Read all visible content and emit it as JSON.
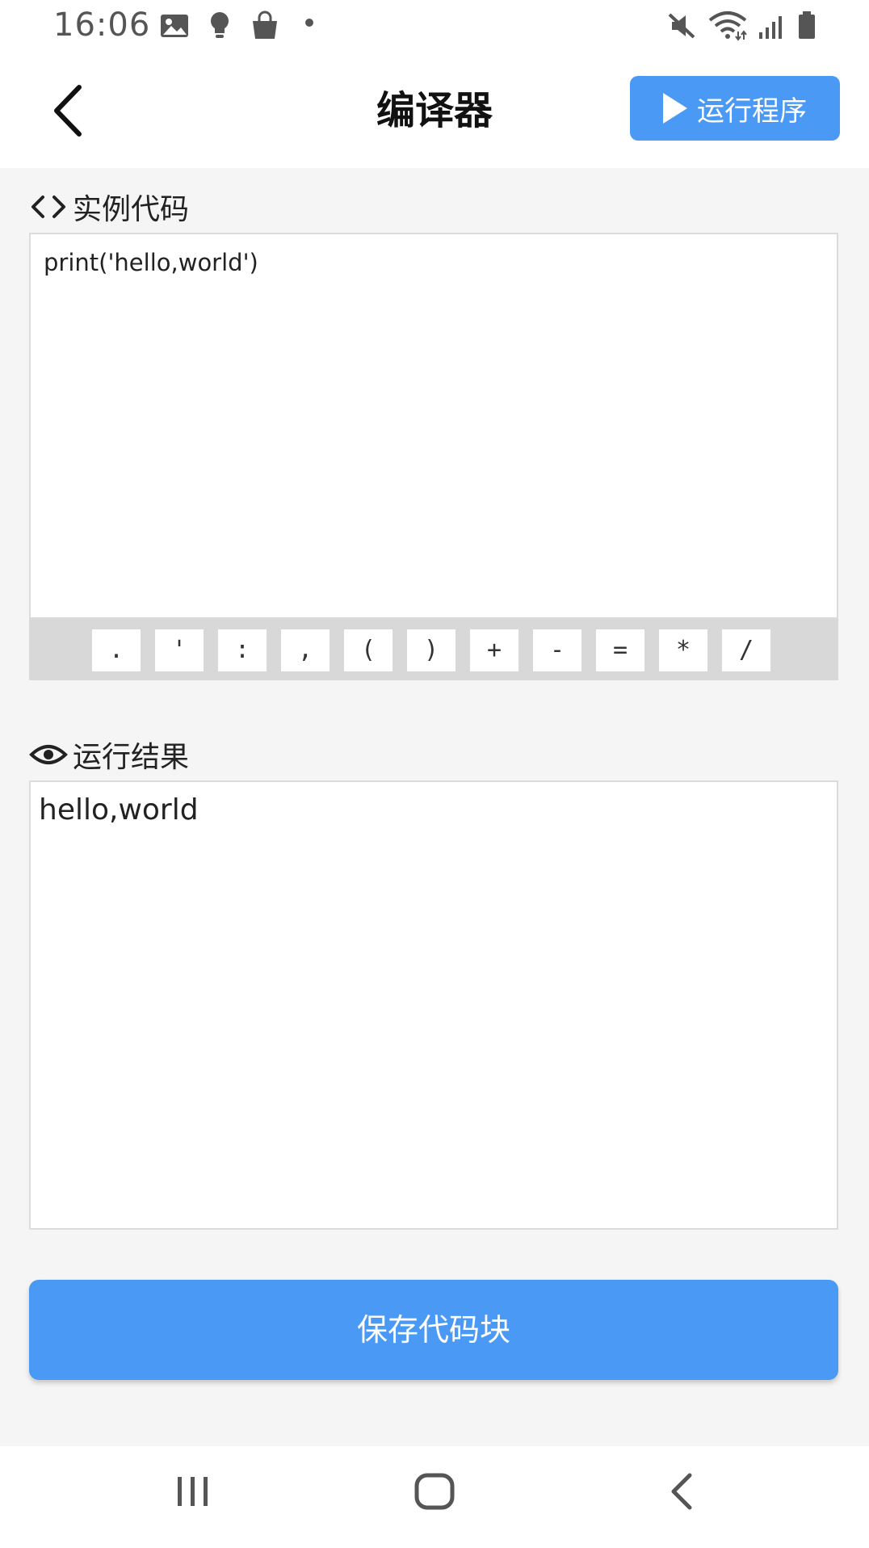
{
  "status_bar": {
    "time": "16:06",
    "left_icons": [
      "image-icon",
      "bulb-icon",
      "shopping-bag-icon",
      "dot-icon"
    ],
    "right_icons": [
      "mute-icon",
      "wifi-icon",
      "signal-icon",
      "battery-icon"
    ]
  },
  "header": {
    "title": "编译器",
    "back_icon": "chevron-left-icon",
    "run_button_label": "运行程序",
    "run_icon": "play-icon"
  },
  "code_section": {
    "label": "实例代码",
    "icon": "code-brackets-icon",
    "code": "print('hello,world')"
  },
  "symbol_keys": [
    ".",
    "'",
    ":",
    ",",
    "(",
    ")",
    "+",
    "-",
    "=",
    "*",
    "/"
  ],
  "result_section": {
    "label": "运行结果",
    "icon": "eye-icon",
    "output": "hello,world"
  },
  "save_button_label": "保存代码块",
  "nav_bar": {
    "items": [
      "recent-apps-icon",
      "home-icon",
      "back-icon"
    ]
  },
  "colors": {
    "accent": "#4a9af5",
    "background": "#f5f5f5",
    "symbol_bar": "#d8d8d8"
  }
}
